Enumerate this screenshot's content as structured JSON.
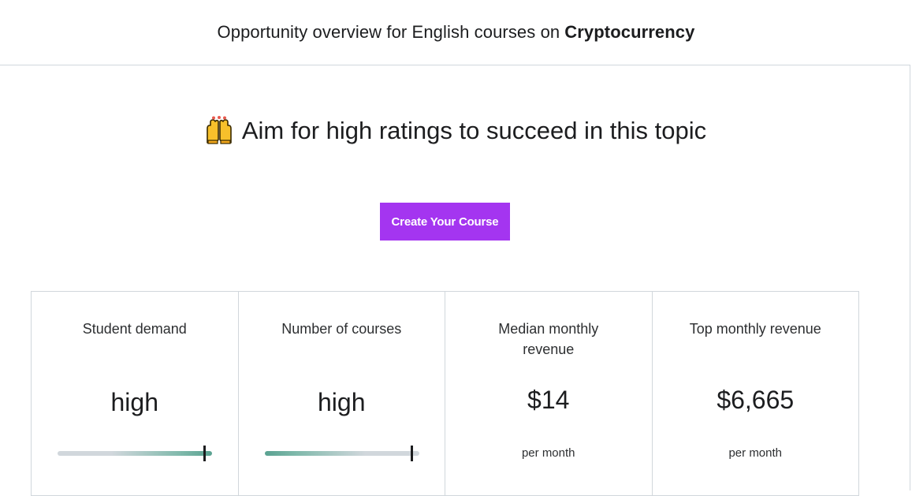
{
  "header": {
    "prefix": "Opportunity overview for English courses on",
    "topic": "Cryptocurrency"
  },
  "headline": {
    "emoji_icon": "raising-hands-icon",
    "text": "Aim for high ratings to succeed in this topic"
  },
  "cta": {
    "label": "Create Your Course",
    "color": "#a435f0"
  },
  "metrics": {
    "student_demand": {
      "title": "Student demand",
      "level": "high",
      "marker_fraction": 0.95
    },
    "number_of_courses": {
      "title": "Number of courses",
      "level": "high",
      "marker_fraction": 0.95
    },
    "median_monthly_revenue": {
      "title": "Median monthly revenue",
      "amount": "$14",
      "unit": "per month"
    },
    "top_monthly_revenue": {
      "title": "Top monthly revenue",
      "amount": "$6,665",
      "unit": "per month"
    }
  },
  "colors": {
    "accent": "#a435f0",
    "slider_high": "#5aa291",
    "slider_low": "#d1d7dc",
    "border": "#d1d7dc"
  }
}
